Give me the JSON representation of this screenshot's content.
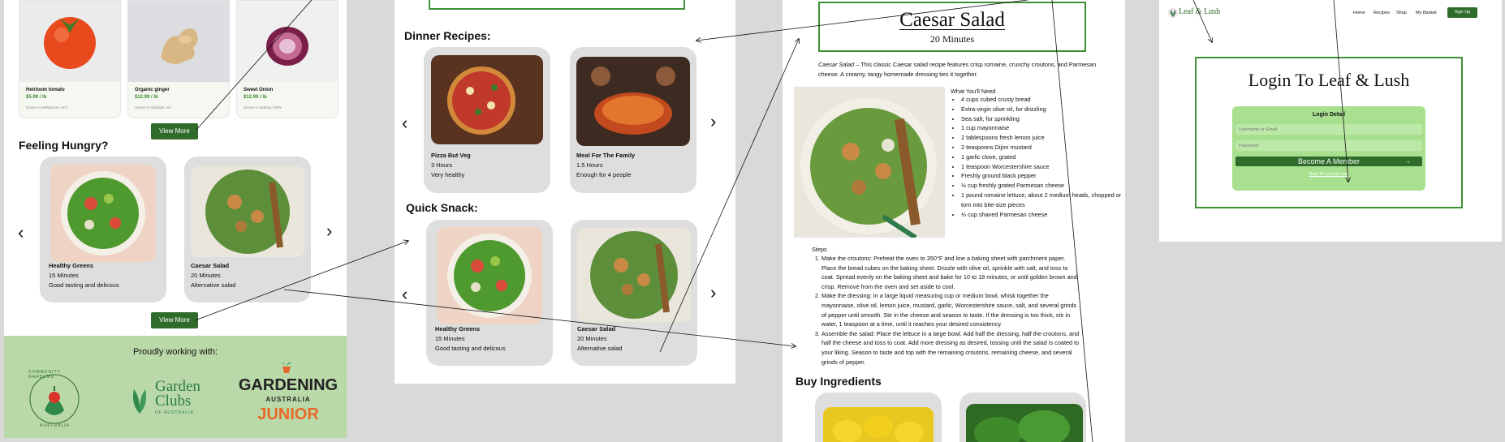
{
  "frame1": {
    "products": [
      {
        "name": "Heirloom tomato",
        "price": "$5.99 / lb",
        "origin": "Grown in Melbourne, ACT"
      },
      {
        "name": "Organic ginger",
        "price": "$12.99 / lb",
        "origin": "Grown in Adelaide, SA"
      },
      {
        "name": "Sweet Onion",
        "price": "$12.99 / lb",
        "origin": "Grown in Sydney, NSW"
      }
    ],
    "view_more_label": "View More",
    "feeling_hungry": "Feeling Hungry?",
    "cards": [
      {
        "title": "Healthy Greens",
        "time": "15 Minutes",
        "desc": "Good tasting and delicous"
      },
      {
        "title": "Caesar Salad",
        "time": "20 Minutes",
        "desc": "Alternative salad"
      }
    ],
    "partners_title": "Proudly working with:",
    "partners": {
      "cga_top": "COMMUNITY GARDENS",
      "cga_bottom": "AUSTRALIA",
      "garden_line1": "Garden",
      "garden_line2": "Clubs",
      "garden_line3": "OF AUSTRALIA",
      "ga_line1": "GARDENING",
      "ga_line2": "AUSTRALIA",
      "ga_line3": "JUNIOR"
    }
  },
  "frame2": {
    "dinner_title": "Dinner Recipes:",
    "dinner_cards": [
      {
        "title": "Pizza But Veg",
        "time": "3 Hours",
        "desc": "Very healthy"
      },
      {
        "title": "Meal For The Family",
        "time": "1.5 Hours",
        "desc": "Enough for 4 people"
      }
    ],
    "snack_title": "Quick Snack:",
    "snack_cards": [
      {
        "title": "Healthy Greens",
        "time": "15 Minutes",
        "desc": "Good tasting and delicous"
      },
      {
        "title": "Caesar Salad",
        "time": "20 Minutes",
        "desc": "Alternative salad"
      }
    ]
  },
  "frame3": {
    "title": "Caesar Salad",
    "subtitle": "20 Minutes",
    "intro_em": "Caesar Salad",
    "intro_rest": " – This classic Caesar salad recipe features crisp romaine, crunchy croutons, and Parmesan cheese. A creamy, tangy homemade dressing ties it together.",
    "need_title": "What You'll Need",
    "ingredients": [
      "4 cups cubed crusty bread",
      "Extra-virgin olive oil, for drizzling",
      "Sea salt, for sprinkling",
      "1 cup mayonnaise",
      "2 tablespoons fresh lemon juice",
      "2 teaspoons Dijon mustard",
      "1 garlic clove, grated",
      "1 teaspoon Worcestershire sauce",
      "Freshly ground black pepper",
      "½ cup freshly grated Parmesan cheese",
      "1 pound romaine lettuce, about 2 medium heads, chopped or torn into bite-size pieces",
      "⅓ cup shaved Parmesan cheese"
    ],
    "steps_title": "Steps",
    "steps": [
      "Make the croutons: Preheat the oven to 350°F and line a baking sheet with parchment paper. Place the bread cubes on the baking sheet. Drizzle with olive oil, sprinkle with salt, and toss to coat. Spread evenly on the baking sheet and bake for 10 to 18 minutes, or until golden brown and crisp. Remove from the oven and set aside to cool.",
      "Make the dressing: In a large liquid measuring cup or medium bowl, whisk together the mayonnaise, olive oil, lemon juice, mustard, garlic, Worcestershire sauce, salt, and several grinds of pepper until smooth. Stir in the cheese and season to taste. If the dressing is too thick, stir in water, 1 teaspoon at a time, until it reaches your desired consistency.",
      "Assemble the salad: Place the lettuce in a large bowl. Add half the dressing, half the croutons, and half the cheese and toss to coat. Add more dressing as desired, tossing until the salad is coated to your liking. Season to taste and top with the remaining croutons, remaining cheese, and several grinds of pepper."
    ],
    "buy_title": "Buy Ingredients"
  },
  "frame4": {
    "brand": "Leaf & Lush",
    "nav": [
      "Home",
      "Recipes",
      "Shop",
      "My Basket"
    ],
    "signup": "Sign Up",
    "login_title": "Login To Leaf & Lush",
    "login_detail": "Login Detail",
    "username_placeholder": "Username or Email",
    "password_placeholder": "Password",
    "become_member": "Become A Member",
    "new_link": "New To Leaf & Lush"
  },
  "colors": {
    "green_dark": "#2f6b2a",
    "green_light": "#a8e08f",
    "partner_bg": "#b9d9a8",
    "border_green": "#3f8f34"
  }
}
